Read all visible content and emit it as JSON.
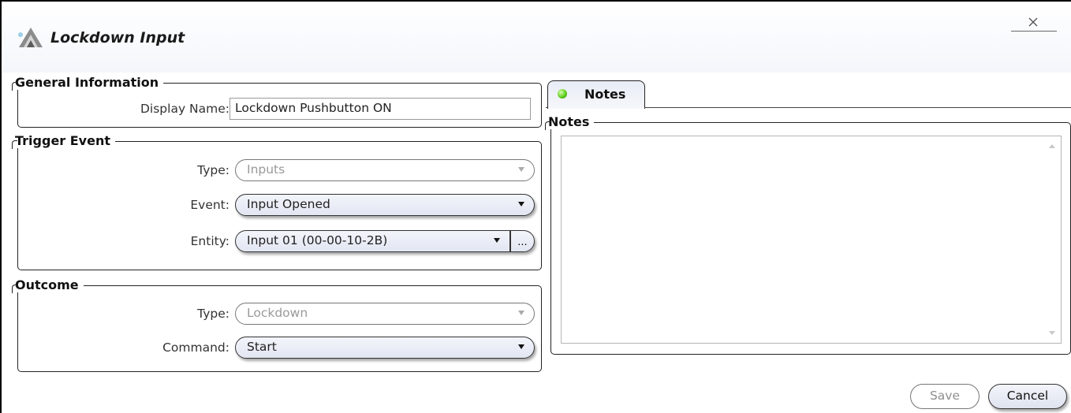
{
  "window": {
    "title": "Lockdown Input",
    "close_glyph": "✕",
    "icon": "app-logo-icon"
  },
  "general_information": {
    "legend": "General Information",
    "display_name_label": "Display Name:",
    "display_name_value": "Lockdown Pushbutton ON"
  },
  "trigger_event": {
    "legend": "Trigger Event",
    "type_label": "Type:",
    "type_value": "Inputs",
    "event_label": "Event:",
    "event_value": "Input Opened",
    "entity_label": "Entity:",
    "entity_value": "Input 01 (00-00-10-2B)",
    "entity_browse_label": "..."
  },
  "outcome": {
    "legend": "Outcome",
    "type_label": "Type:",
    "type_value": "Lockdown",
    "command_label": "Command:",
    "command_value": "Start"
  },
  "notes_tab": {
    "tab_label": "Notes",
    "status_color": "#5fce1e",
    "group_legend": "Notes",
    "notes_value": ""
  },
  "footer": {
    "save_label": "Save",
    "cancel_label": "Cancel"
  }
}
